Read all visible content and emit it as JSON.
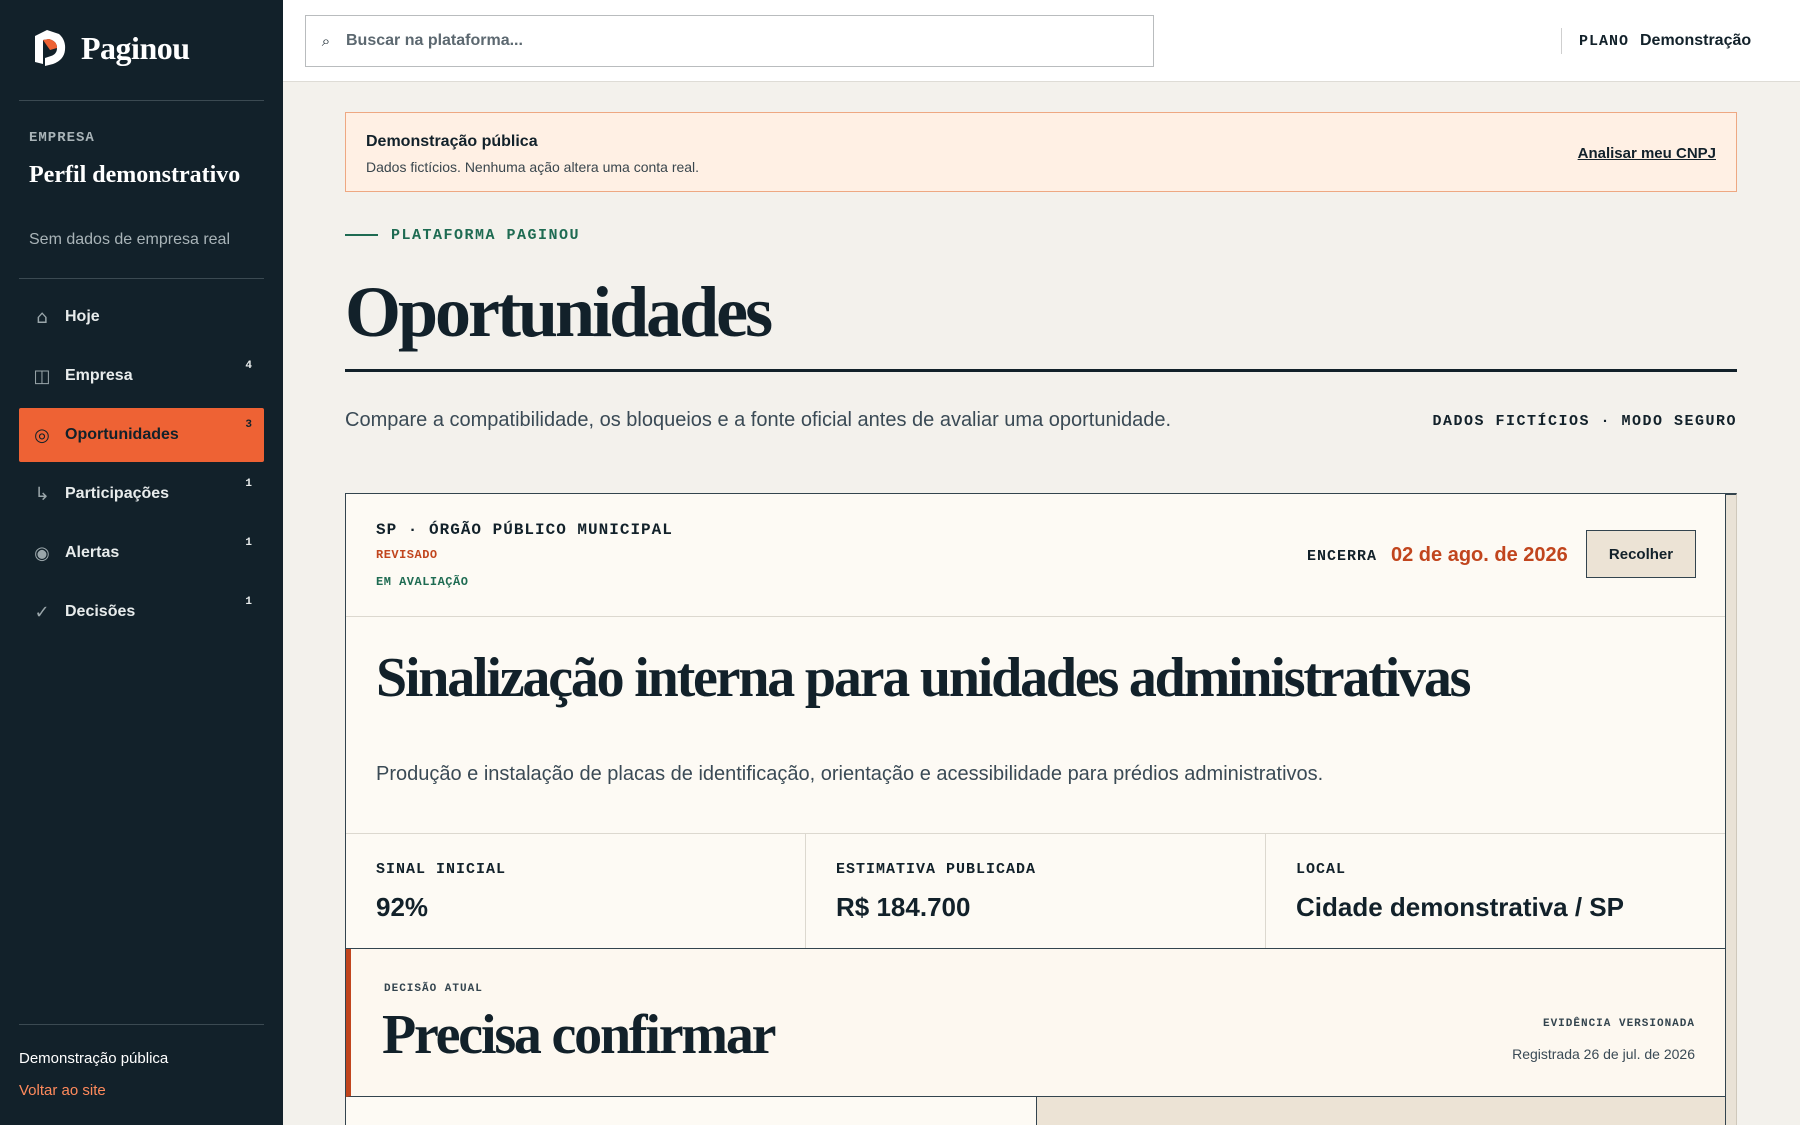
{
  "brand": {
    "name": "Paginou"
  },
  "company": {
    "label": "EMPRESA",
    "name": "Perfil demonstrativo",
    "subtitle": "Sem dados de empresa real"
  },
  "nav": [
    {
      "label": "Hoje",
      "icon": "home-icon",
      "glyph": "⌂",
      "badge": ""
    },
    {
      "label": "Empresa",
      "icon": "building-icon",
      "glyph": "◫",
      "badge": "4"
    },
    {
      "label": "Oportunidades",
      "icon": "target-icon",
      "glyph": "◎",
      "badge": "3",
      "active": true
    },
    {
      "label": "Participações",
      "icon": "arrow-return-icon",
      "glyph": "↳",
      "badge": "1"
    },
    {
      "label": "Alertas",
      "icon": "alert-dot-icon",
      "glyph": "◉",
      "badge": "1"
    },
    {
      "label": "Decisões",
      "icon": "check-icon",
      "glyph": "✓",
      "badge": "1"
    }
  ],
  "sidebar_footer": {
    "mode": "Demonstração pública",
    "back_link": "Voltar ao site"
  },
  "header": {
    "search_placeholder": "Buscar na plataforma...",
    "plan_key": "PLANO",
    "plan_value": "Demonstração"
  },
  "notice": {
    "title": "Demonstração pública",
    "text": "Dados fictícios. Nenhuma ação altera uma conta real.",
    "link": "Analisar meu CNPJ"
  },
  "page": {
    "eyebrow": "PLATAFORMA PAGINOU",
    "title": "Oportunidades",
    "lead": "Compare a compatibilidade, os bloqueios e a fonte oficial antes de avaliar uma oportunidade.",
    "meta": "DADOS FICTÍCIOS · MODO SEGURO"
  },
  "opportunity": {
    "org": "SP · ÓRGÃO PÚBLICO MUNICIPAL",
    "tags": [
      "REVISADO",
      "EM AVALIAÇÃO"
    ],
    "closes_key": "ENCERRA",
    "closes_value": "02 de ago. de 2026",
    "collapse_label": "Recolher",
    "title": "Sinalização interna para unidades administrativas",
    "description": "Produção e instalação de placas de identificação, orientação e acessibilidade para prédios administrativos.",
    "metrics": [
      {
        "key": "SINAL INICIAL",
        "value": "92%"
      },
      {
        "key": "ESTIMATIVA PUBLICADA",
        "value": "R$ 184.700"
      },
      {
        "key": "LOCAL",
        "value": "Cidade demonstrativa / SP"
      }
    ],
    "decision": {
      "key": "DECISÃO ATUAL",
      "value": "Precisa confirmar",
      "evidence_key": "EVIDÊNCIA VERSIONADA",
      "evidence_value": "Registrada 26 de jul. de 2026"
    }
  },
  "colors": {
    "sidebar_bg": "#12212a",
    "accent_orange": "#ee6234",
    "accent_rust": "#c1451d",
    "accent_green": "#1e6b52",
    "page_bg": "#f3f1ec",
    "card_bg": "#fdfaf4"
  }
}
